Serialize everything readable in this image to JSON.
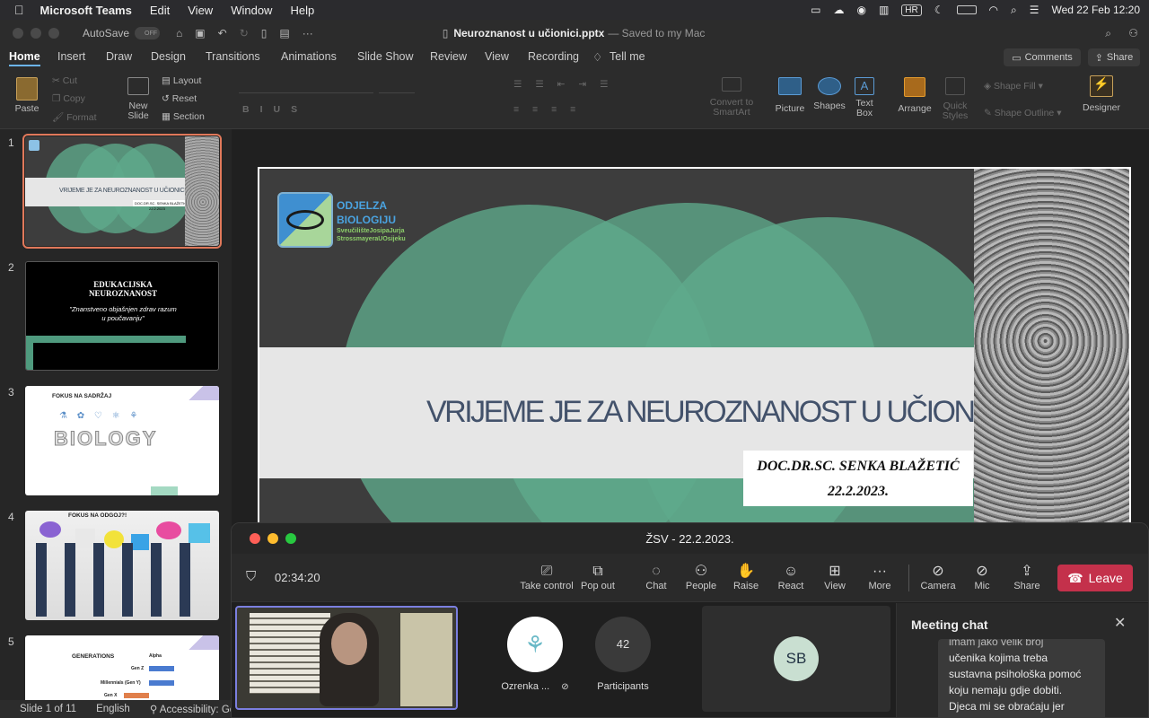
{
  "menubar": {
    "app": "Microsoft Teams",
    "items": [
      "Edit",
      "View",
      "Window",
      "Help"
    ],
    "lang": "HR",
    "datetime": "Wed 22 Feb  12:20"
  },
  "ppt": {
    "autosave_label": "AutoSave",
    "autosave_state": "OFF",
    "title": "Neuroznanost u učionici.pptx",
    "saved": "— Saved to my Mac",
    "tabs": [
      "Home",
      "Insert",
      "Draw",
      "Design",
      "Transitions",
      "Animations",
      "Slide Show",
      "Review",
      "View",
      "Recording",
      "Tell me"
    ],
    "comments": "Comments",
    "share": "Share",
    "ribbon": {
      "paste": "Paste",
      "cut": "Cut",
      "copy": "Copy",
      "format": "Format",
      "new_slide": "New Slide",
      "layout": "Layout",
      "reset": "Reset",
      "section": "Section",
      "convert": "Convert to SmartArt",
      "picture": "Picture",
      "shapes": "Shapes",
      "text_box": "Text Box",
      "arrange": "Arrange",
      "quick_styles": "Quick Styles",
      "shape_fill": "Shape Fill",
      "shape_outline": "Shape Outline",
      "designer": "Designer"
    },
    "status": {
      "slide": "Slide 1 of 11",
      "language": "English",
      "accessibility": "Accessibility: Goo"
    }
  },
  "thumbnails": [
    {
      "num": "1",
      "title": "VRIJEME JE ZA NEUROZNANOST U UČIONICI",
      "sub": "DOC.DR.SC. SENKA BLAŽETIĆ",
      "date": "22.2.2023"
    },
    {
      "num": "2",
      "title": "EDUKACIJSKA NEUROZNANOST",
      "sub": "\"Znanstveno objašnjen zdrav razum u poučavanju\""
    },
    {
      "num": "3",
      "title": "FOKUS NA SADRŽAJ",
      "art": "BIOLOGY"
    },
    {
      "num": "4",
      "title": "FOKUS NA ODGOJ?!"
    },
    {
      "num": "5",
      "title": "GENERATIONS",
      "rows": [
        "Alpha",
        "Gen Z",
        "Millennials (Gen Y)",
        "Gen X"
      ]
    }
  ],
  "slide": {
    "logo_line1": "ODJELZA",
    "logo_line2": "BIOLOGIJU",
    "logo_line3": "SveučilišteJosipaJurja",
    "logo_line4": "StrossmayeraUOsijeku",
    "title": "VRIJEME JE ZA NEUROZNANOST U UČIONICI",
    "author": "DOC.DR.SC. SENKA BLAŽETIĆ",
    "date": "22.2.2023."
  },
  "teams": {
    "title": "ŽSV - 22.2.2023.",
    "timer": "02:34:20",
    "controls": [
      "Take control",
      "Pop out",
      "Chat",
      "People",
      "Raise",
      "React",
      "View",
      "More",
      "Camera",
      "Mic",
      "Share"
    ],
    "leave": "Leave",
    "participant_name": "Ozrenka ...",
    "participants_count": "42",
    "participants_label": "Participants",
    "avatar_initials": "SB",
    "chat": {
      "title": "Meeting chat",
      "text": [
        "imam jako velik broj",
        "učenika kojima treba",
        "sustavna psihološka pomoć",
        "koju nemaju gdje dobiti.",
        "Djeca mi se obraćaju jer"
      ]
    }
  },
  "colors": {
    "accent_green": "#5fa98b",
    "leave_red": "#c4314b",
    "tab_active": "#6cb4ee"
  }
}
